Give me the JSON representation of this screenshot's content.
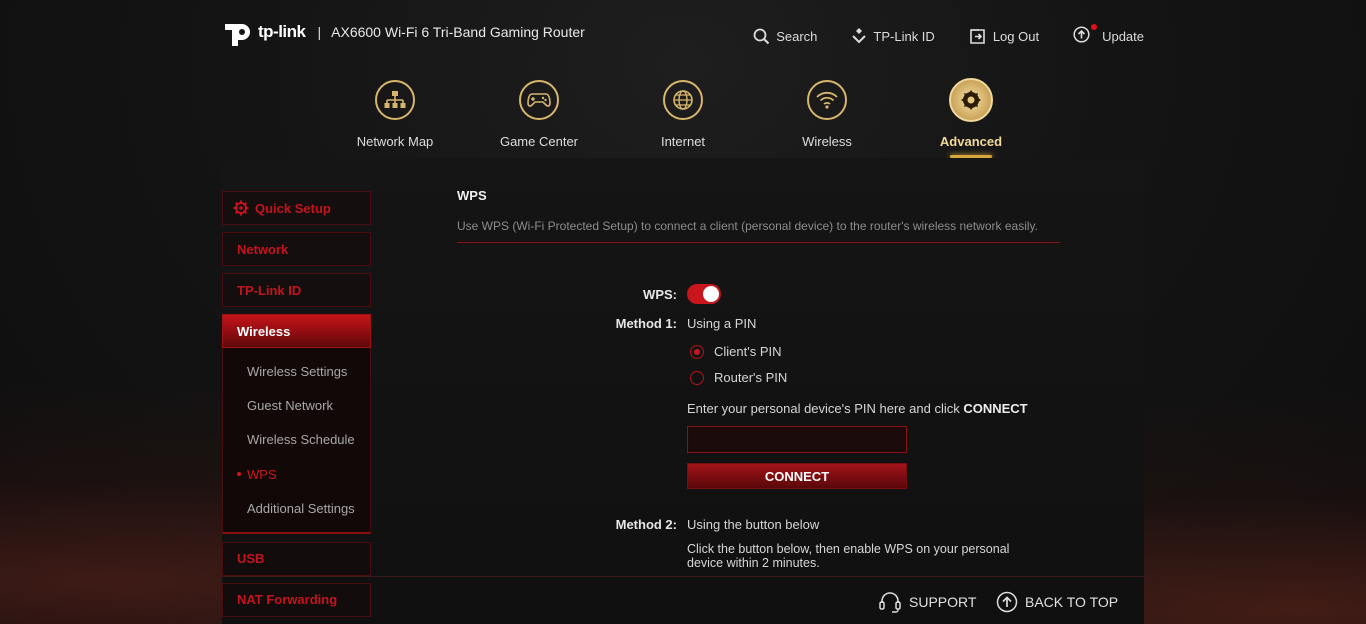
{
  "header": {
    "brand": "tp-link",
    "separator": "|",
    "model": "AX6600 Wi-Fi 6 Tri-Band Gaming Router",
    "actions": {
      "search": "Search",
      "tplink_id": "TP-Link ID",
      "logout": "Log Out",
      "update": "Update"
    }
  },
  "mainnav": {
    "items": [
      {
        "label": "Network Map",
        "icon": "network-map-icon"
      },
      {
        "label": "Game Center",
        "icon": "gamepad-icon"
      },
      {
        "label": "Internet",
        "icon": "globe-icon"
      },
      {
        "label": "Wireless",
        "icon": "wifi-icon"
      },
      {
        "label": "Advanced",
        "icon": "gear-icon",
        "active": true
      }
    ]
  },
  "sidebar": {
    "quick_setup": "Quick Setup",
    "network": "Network",
    "tplink_id": "TP-Link ID",
    "wireless": "Wireless",
    "wireless_sub": [
      "Wireless Settings",
      "Guest Network",
      "Wireless Schedule",
      "WPS",
      "Additional Settings"
    ],
    "usb": "USB",
    "nat": "NAT Forwarding"
  },
  "content": {
    "title": "WPS",
    "description": "Use WPS (Wi-Fi Protected Setup) to connect a client (personal device) to the router's wireless network easily.",
    "wps_label": "WPS:",
    "wps_enabled": true,
    "method1_label": "Method 1:",
    "method1_value": "Using a PIN",
    "radio_client": "Client's PIN",
    "radio_router": "Router's PIN",
    "selected_radio": "Client's PIN",
    "pin_instruction": "Enter your personal device's PIN here and click ",
    "pin_instruction_bold": "CONNECT",
    "pin_value": "",
    "connect_button": "CONNECT",
    "method2_label": "Method 2:",
    "method2_value": "Using the button below",
    "method2_desc": "Click the button below, then enable WPS on your personal device within 2 minutes."
  },
  "footer": {
    "support": "SUPPORT",
    "back_to_top": "BACK TO TOP"
  },
  "colors": {
    "accent_red": "#c9151c",
    "gold": "#d7b56d"
  }
}
